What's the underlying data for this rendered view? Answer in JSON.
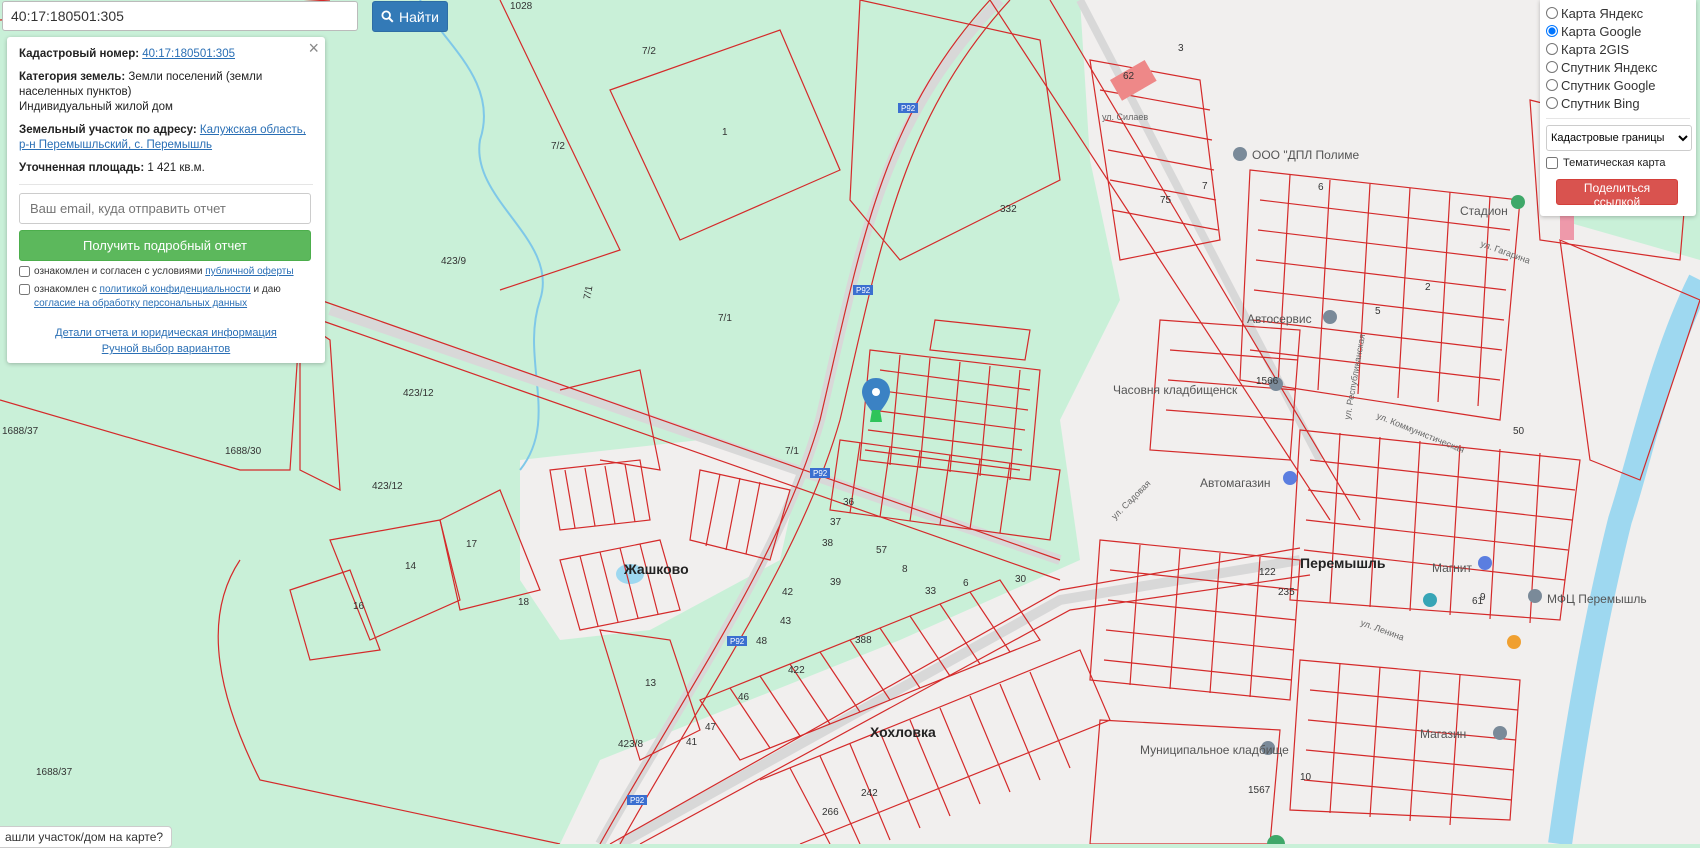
{
  "search": {
    "value": "40:17:180501:305",
    "button_label": "Найти"
  },
  "info": {
    "cadastral_label": "Кадастровый номер:",
    "cadastral_value": "40:17:180501:305",
    "category_label": "Категория земель:",
    "category_value": "Земли поселений (земли населенных пунктов)",
    "usage_value": "Индивидуальный жилой дом",
    "address_label": "Земельный участок по адресу:",
    "address_value": "Калужская область, р-н Перемышльский, с. Перемышль",
    "area_label": "Уточненная площадь:",
    "area_value": "1 421 кв.м.",
    "email_placeholder": "Ваш email, куда отправить отчет",
    "report_button": "Получить подробный отчет",
    "agree1_text": "ознакомлен и согласен с условиями",
    "agree1_link": "публичной оферты",
    "agree2_text": "ознакомлен с",
    "agree2_link": "политикой конфиденциальности",
    "agree2_text2": "и даю",
    "agree2_link2": "согласие на обработку персональных данных",
    "details_link": "Детали отчета и юридическая информация",
    "manual_link": "Ручной выбор вариантов",
    "close_symbol": "×"
  },
  "layers": {
    "options": [
      "Карта Яндекс",
      "Карта Google",
      "Карта 2GIS",
      "Спутник Яндекс",
      "Спутник Google",
      "Спутник Bing"
    ],
    "selected_index": 1,
    "boundaries_select": "Кадастровые границы",
    "thematic_label": "Тематическая карта",
    "share_button": "Поделиться ссылкой"
  },
  "hint": "ашли участок/дом на карте?",
  "map": {
    "towns": [
      "Жашково",
      "Хохловка",
      "Перемышль"
    ],
    "pois": [
      "ООО \"ДПЛ Полиме",
      "Автосервис",
      "Часовня кладбищенск",
      "Автомагазин",
      "МФЦ Перемышль",
      "Стадион",
      "Магнит",
      "Муниципальное кладбище",
      "Магазин"
    ],
    "parcels": [
      "1028",
      "7/2",
      "7/2",
      "1",
      "332",
      "423/9",
      "7/1",
      "7/1",
      "423/12",
      "423/12",
      "1688/37",
      "1688/30",
      "7/1",
      "17",
      "14",
      "16",
      "18",
      "13",
      "423/8",
      "1688/37",
      "388",
      "422",
      "266",
      "242",
      "30",
      "33",
      "6",
      "8",
      "57",
      "36",
      "37",
      "38",
      "39",
      "42",
      "43",
      "48",
      "46",
      "47",
      "41",
      "3",
      "62",
      "75",
      "1566",
      "50",
      "61",
      "10",
      "122",
      "235",
      "1567",
      "5",
      "6",
      "7",
      "9",
      "2"
    ],
    "roads": [
      "Р92",
      "Р92",
      "Р92",
      "Р92",
      "Р92"
    ],
    "streets": [
      "ул. Садовая",
      "ул. Гагарина",
      "ул. Коммунистическая",
      "ул. Республиканская",
      "ул. Ленина",
      "ул. Силаев"
    ]
  }
}
